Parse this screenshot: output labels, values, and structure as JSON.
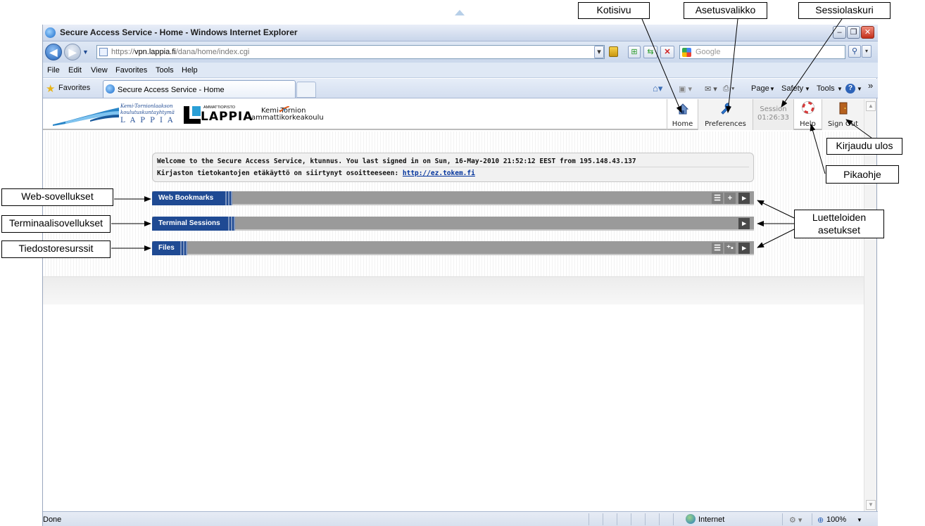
{
  "window": {
    "title": "Secure Access Service - Home - Windows Internet Explorer",
    "controls": [
      "minimize",
      "restore",
      "close"
    ]
  },
  "address_bar": {
    "url_prefix": "https://",
    "url_host": "vpn.lappia.fi",
    "url_path": "/dana/home/index.cgi",
    "search_placeholder": "Google"
  },
  "menu": [
    "File",
    "Edit",
    "View",
    "Favorites",
    "Tools",
    "Help"
  ],
  "favorites_label": "Favorites",
  "tab": {
    "label": "Secure Access Service - Home"
  },
  "command_bar": {
    "page": "Page",
    "safety": "Safety",
    "tools": "Tools",
    "chevron": "»"
  },
  "logos": {
    "koulutus_line1": "Kemi-Tornionlaakson",
    "koulutus_line2": "koulutuskuntayhtymä",
    "koulutus_line3": "L A P P I A",
    "ammattiopisto_small": "AMMATTIOPISTO",
    "ammattiopisto_big": "LAPPIA",
    "amk_line1": "Kemi-Tornion",
    "amk_line2": "ammattikorkeakoulu"
  },
  "header_buttons": {
    "home": "Home",
    "preferences": "Preferences",
    "session_label": "Session",
    "session_time": "01:26:33",
    "help": "Help",
    "signout": "Sign Out"
  },
  "welcome": {
    "line1": "Welcome to the Secure Access Service, ktunnus. You last signed in on  Sun, 16-May-2010 21:52:12 EEST  from  195.148.43.137",
    "line2_text": "Kirjaston tietokantojen etäkäyttö on siirtynyt osoitteeseen: ",
    "line2_link": "http://ez.tokem.fi"
  },
  "panels": [
    {
      "title": "Web Bookmarks",
      "icons": [
        "list-options",
        "add",
        "expand"
      ]
    },
    {
      "title": "Terminal Sessions",
      "icons": [
        "expand"
      ]
    },
    {
      "title": "Files",
      "icons": [
        "list-options",
        "add-files",
        "expand"
      ]
    }
  ],
  "status": {
    "left": "Done",
    "zone": "Internet",
    "zoom": "100%"
  },
  "callouts": {
    "kotisivu": "Kotisivu",
    "asetusvalikko": "Asetusvalikko",
    "sessiolaskuri": "Sessiolaskuri",
    "kirjaudu_ulos": "Kirjaudu ulos",
    "pikaohje": "Pikaohje",
    "web_sovellukset": "Web-sovellukset",
    "terminaalisovellukset": "Terminaalisovellukset",
    "tiedostoresurssit": "Tiedostoresurssit",
    "luetteloiden_line1": "Luetteloiden",
    "luetteloiden_line2": "asetukset"
  },
  "colors": {
    "panel_title_bg": "#1f4a93",
    "panel_bar_bg": "#9a9a9a",
    "link": "#00329c"
  }
}
